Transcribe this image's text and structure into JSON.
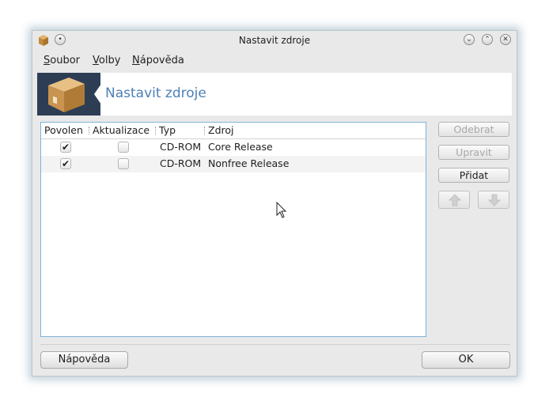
{
  "window": {
    "title": "Nastavit zdroje",
    "icon": "package-icon"
  },
  "menu": {
    "items": [
      "Soubor",
      "Volby",
      "Nápověda"
    ]
  },
  "banner": {
    "title": "Nastavit zdroje",
    "icon": "package-box-icon"
  },
  "list": {
    "columns": [
      "Povolen",
      "Aktualizace",
      "Typ",
      "Zdroj"
    ],
    "rows": [
      {
        "enabled": true,
        "update": false,
        "type": "CD-ROM",
        "source": "Core Release"
      },
      {
        "enabled": true,
        "update": false,
        "type": "CD-ROM",
        "source": "Nonfree Release"
      }
    ]
  },
  "actions": {
    "remove": "Odebrat",
    "edit": "Upravit",
    "add": "Přidat"
  },
  "footer": {
    "help": "Nápověda",
    "ok": "OK"
  },
  "colors": {
    "accent": "#4c7fb7",
    "banner_bg": "#2d3e54",
    "list_border": "#7fb2d8"
  }
}
